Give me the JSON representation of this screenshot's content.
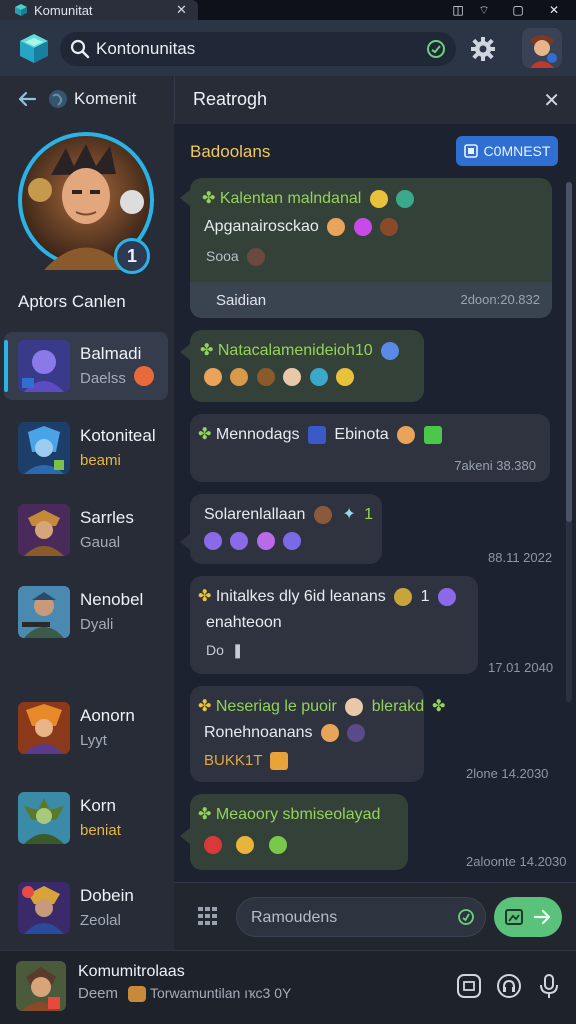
{
  "titlebar": {
    "tab_label": "Komunitat",
    "close_tab": "✕",
    "controls": [
      "◫",
      "⌔",
      "▢",
      "✕"
    ]
  },
  "header": {
    "search_value": "Kontonunitas"
  },
  "sidebar": {
    "back_label": "Komenit",
    "profile": {
      "name": "Aptors Canlen",
      "badge": "1"
    },
    "channels": [
      {
        "name": "Balmadi",
        "sub": "Daelss",
        "active": true
      },
      {
        "name": "Kotoniteal",
        "sub": "beami",
        "gold": true
      },
      {
        "name": "Sarrles",
        "sub": "Gaual"
      },
      {
        "name": "Nenobel",
        "sub": "Dyali"
      },
      {
        "name": "Aonorn",
        "sub": "Lyyt"
      },
      {
        "name": "Korn",
        "sub": "beniat",
        "gold": true
      },
      {
        "name": "Dobein",
        "sub": "Zeolal"
      }
    ]
  },
  "bottom": {
    "name": "Komumitrolaas",
    "sub": "Deem",
    "sub2": "Torwamuntilan ıҡc3 0Y"
  },
  "panel": {
    "title": "Reatrogh",
    "close": "✕",
    "room_title": "Badoolans",
    "connect_label": "C0MNEST"
  },
  "messages": [
    {
      "lines": [
        "Kalentan malndanal",
        "Apganairosckao",
        "Sooa"
      ],
      "footer": "Saidian",
      "time": "2doon:20.832"
    },
    {
      "lines": [
        "Natacalamenideioh10"
      ]
    },
    {
      "lines": [
        "Mennodags",
        "Ebinota"
      ],
      "time": "7akeni 38.380"
    },
    {
      "lines": [
        "Solarenlallaan",
        "1"
      ],
      "stamp": "88.11 2022"
    },
    {
      "lines": [
        "Initalkes dly 6id leanans",
        "1",
        "enahteoon",
        "Do"
      ],
      "stamp": "17.01 2040"
    },
    {
      "lines": [
        "Neseriag le puoir",
        "blerakd",
        "Ronehnoanans",
        "BUKK1T"
      ],
      "stamp": "2lone 14.2030"
    },
    {
      "lines": [
        "Meaoory sbmiseolayad"
      ],
      "stamp": "2aloonte 14.2030"
    }
  ],
  "composer": {
    "placeholder": "Ramoudens"
  },
  "colors": {
    "accent_blue": "#2e6fd1",
    "accent_green": "#5bc27b",
    "gold": "#f0c95a",
    "green_text": "#93d35a"
  }
}
